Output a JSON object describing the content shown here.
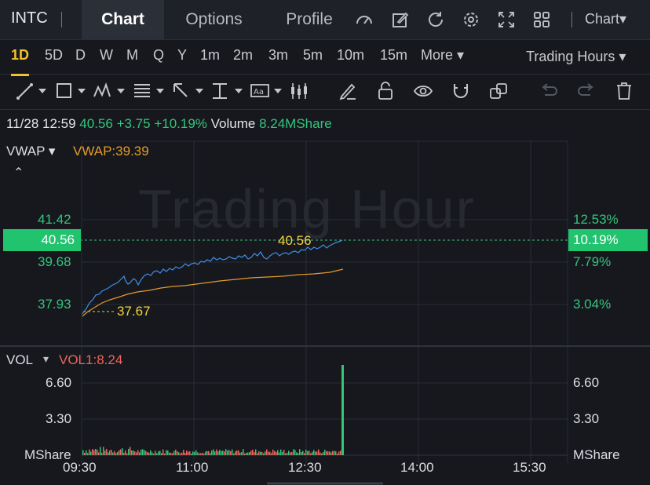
{
  "header": {
    "ticker": "INTC",
    "tabs": [
      {
        "label": "Chart",
        "active": true
      },
      {
        "label": "Options",
        "active": false
      },
      {
        "label": "Profile",
        "active": false
      }
    ],
    "icons": [
      "gauge-icon",
      "edit-icon",
      "refresh-icon",
      "settings-icon",
      "fullscreen-icon",
      "grid-icon"
    ],
    "chart_menu": "Chart▾"
  },
  "periods": {
    "items": [
      "1D",
      "5D",
      "D",
      "W",
      "M",
      "Q",
      "Y",
      "1m",
      "2m",
      "3m",
      "5m",
      "10m",
      "15m",
      "More ▾"
    ],
    "active": "1D",
    "trading_hours": "Trading Hours ▾"
  },
  "toolbar": {
    "icons": [
      "trendline-icon",
      "rectangle-icon",
      "pattern-icon",
      "fib-icon",
      "arrow-icon",
      "measure-icon",
      "text-icon",
      "candle-icon",
      "pencil-icon",
      "lock-icon",
      "eye-icon",
      "magnet-icon",
      "layers-icon",
      "undo-icon",
      "redo-icon",
      "trash-icon"
    ]
  },
  "quote": {
    "time": "11/28 12:59",
    "price": "40.56",
    "change": "+3.75",
    "change_pct": "+10.19%",
    "volume_label": "Volume",
    "volume": "8.24MShare"
  },
  "price_panel": {
    "indicator": "VWAP ▾",
    "vwap_value": "VWAP:39.39",
    "collapse": "⌃",
    "watermark": "Trading Hour",
    "left_ticks": [
      "41.42",
      "39.68",
      "37.93"
    ],
    "right_ticks": [
      "12.53%",
      "7.79%",
      "3.04%"
    ],
    "current_price_tag": "40.56",
    "current_pct_tag": "10.19%",
    "high_label": "40.56",
    "low_label": "37.67"
  },
  "volume_panel": {
    "indicator": "VOL",
    "dropdown": "▾",
    "vol_value": "VOL1:8.24",
    "left_ticks": [
      "6.60",
      "3.30",
      "MShare"
    ],
    "right_ticks": [
      "6.60",
      "3.30",
      "MShare"
    ]
  },
  "x_axis": [
    "09:30",
    "11:00",
    "12:30",
    "14:00",
    "15:30"
  ],
  "colors": {
    "up": "#35c47c",
    "down": "#f0645a",
    "price_line": "#3f8fe8",
    "vwap_line": "#e39a2b",
    "highlight": "#f4d23a",
    "background": "#16181e"
  },
  "chart_data": {
    "type": "line",
    "x": [
      "09:30",
      "11:00",
      "12:30",
      "14:00",
      "15:30"
    ],
    "series": [
      {
        "name": "VWAP",
        "values": [
          37.7,
          38.9,
          39.3
        ]
      },
      {
        "name": "VOL",
        "values": [
          8.24
        ]
      }
    ],
    "ylim": [
      37.5,
      41.7
    ]
  }
}
